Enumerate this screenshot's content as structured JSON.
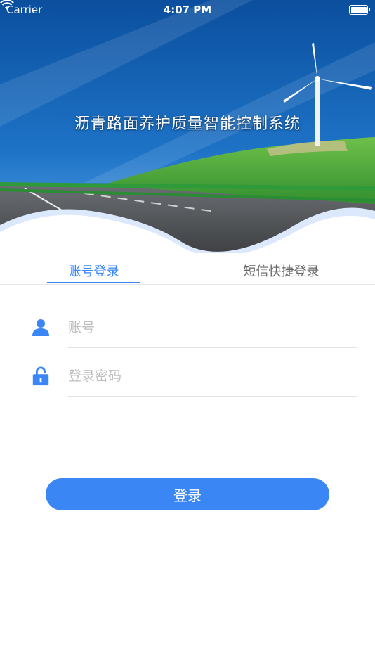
{
  "status_bar": {
    "carrier": "Carrier",
    "time": "4:07 PM"
  },
  "header": {
    "title": "沥青路面养护质量智能控制系统"
  },
  "tabs": [
    {
      "label": "账号登录",
      "active": true
    },
    {
      "label": "短信快捷登录",
      "active": false
    }
  ],
  "form": {
    "account": {
      "placeholder": "账号",
      "value": "",
      "icon": "user-icon"
    },
    "password": {
      "placeholder": "登录密码",
      "value": "",
      "icon": "lock-icon"
    },
    "submit_label": "登录"
  },
  "colors": {
    "accent": "#3a86f5",
    "sky": "#1a66b8",
    "grass": "#3fa83a",
    "road": "#55585c"
  }
}
